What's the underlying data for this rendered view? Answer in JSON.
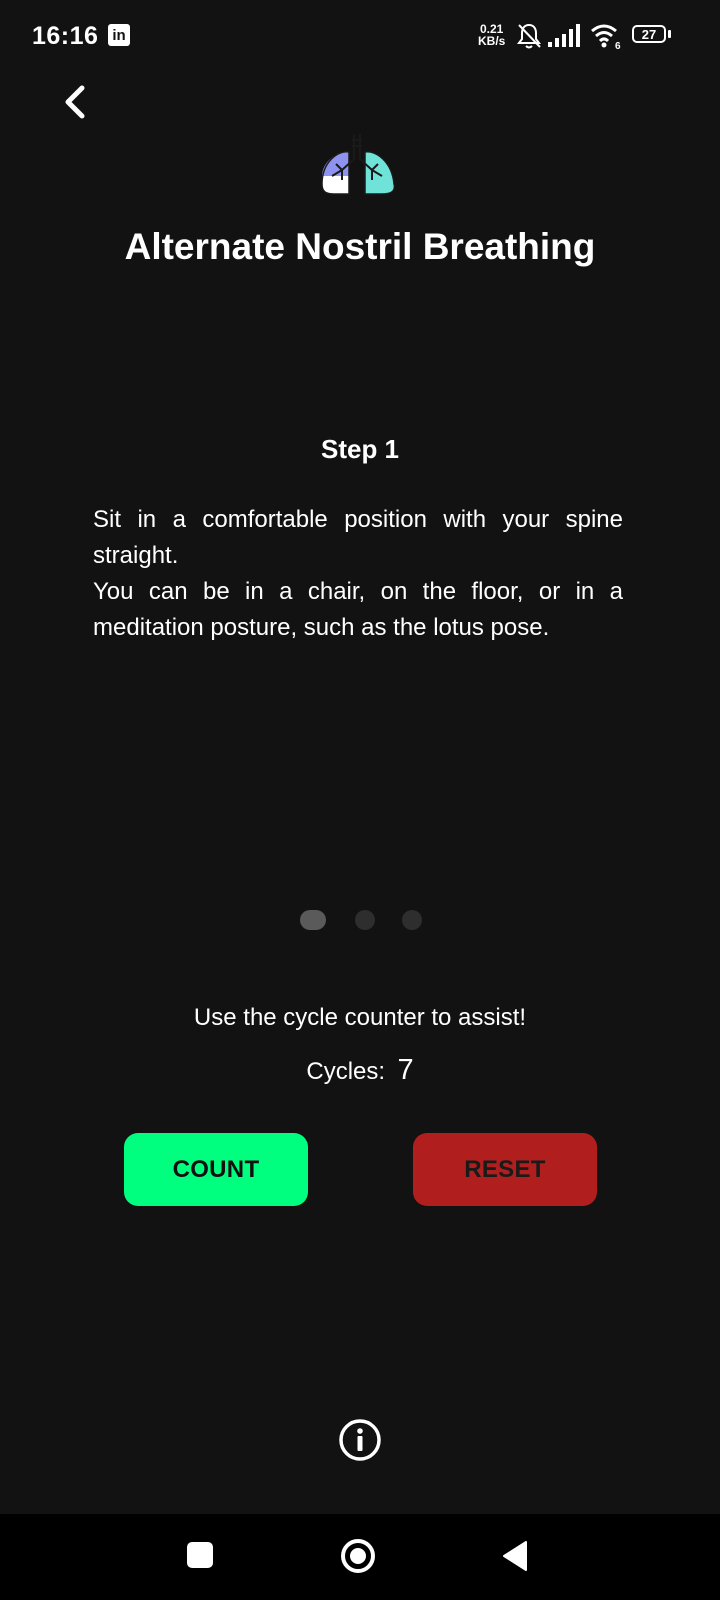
{
  "status_bar": {
    "time": "16:16",
    "app_icon": "linkedin-icon",
    "app_icon_text": "in",
    "net_speed_value": "0.21",
    "net_speed_unit": "KB/s",
    "battery_level": "27",
    "wifi_badge": "6"
  },
  "header": {
    "back_icon": "chevron-left-icon",
    "exercise_icon": "lungs-icon",
    "title": "Alternate Nostril Breathing"
  },
  "step": {
    "title": "Step 1",
    "lines": [
      "Sit in a comfortable position with your spine straight.",
      "You can be in a chair, on the floor, or in a meditation posture, such as the lotus pose."
    ]
  },
  "pager": {
    "current_page": 1,
    "total_pages": 3
  },
  "counter": {
    "hint": "Use the cycle counter to assist!",
    "cycles_label": "Cycles:",
    "cycles_value": "7",
    "count_label": "COUNT",
    "reset_label": "RESET"
  },
  "colors": {
    "background": "#121212",
    "count_button": "#00ff7f",
    "reset_button": "#b01e1e",
    "lungs_left": "#8f93f0",
    "lungs_right": "#6fe3d8"
  },
  "footer": {
    "info_icon": "info-icon"
  },
  "nav_bar": {
    "recents_icon": "square-icon",
    "home_icon": "circle-icon",
    "back_icon": "triangle-back-icon"
  }
}
